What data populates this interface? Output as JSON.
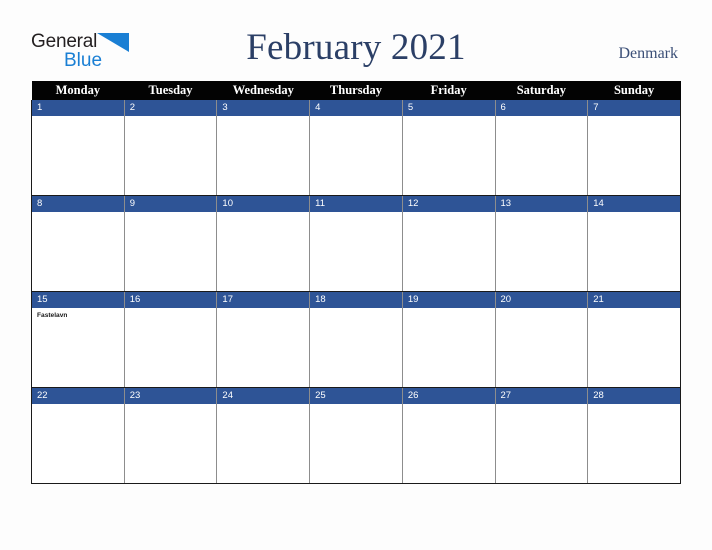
{
  "brand": {
    "name_part1": "General",
    "name_part2": "Blue",
    "triangle_color": "#1a7fd4"
  },
  "header": {
    "title": "February 2021",
    "country": "Denmark"
  },
  "colors": {
    "header_row_bg": "#030303",
    "date_bar_bg": "#2e5496",
    "title_text": "#2b3f66",
    "page_bg": "#fdfdfd"
  },
  "calendar": {
    "weekday_headers": [
      "Monday",
      "Tuesday",
      "Wednesday",
      "Thursday",
      "Friday",
      "Saturday",
      "Sunday"
    ],
    "weeks": [
      {
        "days": [
          {
            "num": "1",
            "events": []
          },
          {
            "num": "2",
            "events": []
          },
          {
            "num": "3",
            "events": []
          },
          {
            "num": "4",
            "events": []
          },
          {
            "num": "5",
            "events": []
          },
          {
            "num": "6",
            "events": []
          },
          {
            "num": "7",
            "events": []
          }
        ]
      },
      {
        "days": [
          {
            "num": "8",
            "events": []
          },
          {
            "num": "9",
            "events": []
          },
          {
            "num": "10",
            "events": []
          },
          {
            "num": "11",
            "events": []
          },
          {
            "num": "12",
            "events": []
          },
          {
            "num": "13",
            "events": []
          },
          {
            "num": "14",
            "events": []
          }
        ]
      },
      {
        "days": [
          {
            "num": "15",
            "events": [
              "Fastelavn"
            ]
          },
          {
            "num": "16",
            "events": []
          },
          {
            "num": "17",
            "events": []
          },
          {
            "num": "18",
            "events": []
          },
          {
            "num": "19",
            "events": []
          },
          {
            "num": "20",
            "events": []
          },
          {
            "num": "21",
            "events": []
          }
        ]
      },
      {
        "days": [
          {
            "num": "22",
            "events": []
          },
          {
            "num": "23",
            "events": []
          },
          {
            "num": "24",
            "events": []
          },
          {
            "num": "25",
            "events": []
          },
          {
            "num": "26",
            "events": []
          },
          {
            "num": "27",
            "events": []
          },
          {
            "num": "28",
            "events": []
          }
        ]
      }
    ]
  }
}
